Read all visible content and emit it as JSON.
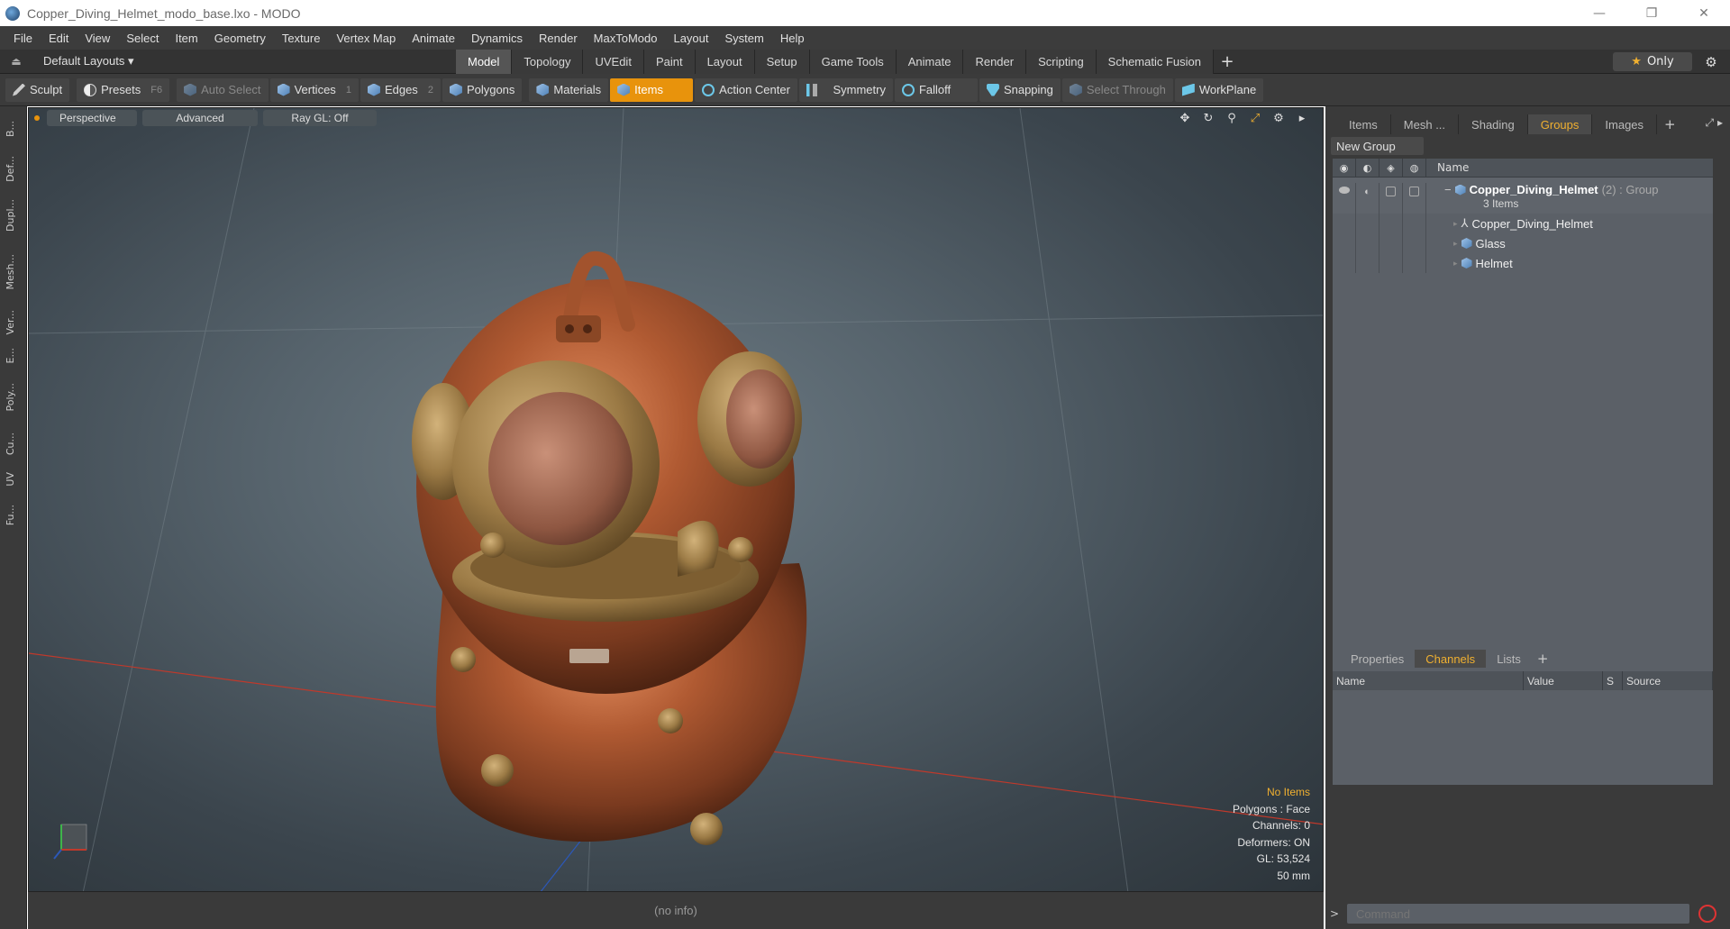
{
  "window": {
    "title": "Copper_Diving_Helmet_modo_base.lxo - MODO",
    "buttons": [
      "—",
      "❐",
      "✕"
    ]
  },
  "menu": [
    "File",
    "Edit",
    "View",
    "Select",
    "Item",
    "Geometry",
    "Texture",
    "Vertex Map",
    "Animate",
    "Dynamics",
    "Render",
    "MaxToModo",
    "Layout",
    "System",
    "Help"
  ],
  "layout_bar": {
    "layouts_label": "Default Layouts ▾",
    "tabs": [
      "Model",
      "Topology",
      "UVEdit",
      "Paint",
      "Layout",
      "Setup",
      "Game Tools",
      "Animate",
      "Render",
      "Scripting",
      "Schematic Fusion"
    ],
    "active_tab": "Model",
    "only_label": "Only"
  },
  "toolbar": {
    "sculpt": "Sculpt",
    "presets": "Presets",
    "presets_key": "F6",
    "auto_select": "Auto Select",
    "vertices": "Vertices",
    "vertices_key": "1",
    "edges": "Edges",
    "edges_key": "2",
    "polygons": "Polygons",
    "materials": "Materials",
    "items": "Items",
    "action_center": "Action Center",
    "symmetry": "Symmetry",
    "falloff": "Falloff",
    "snapping": "Snapping",
    "select_through": "Select Through",
    "workplane": "WorkPlane"
  },
  "left_tabs": [
    "B...",
    "Def...",
    "Dupl...",
    "Mesh...",
    "Ver...",
    "E...",
    "Poly...",
    "Cu...",
    "UV",
    "Fu..."
  ],
  "viewport": {
    "view_label": "Perspective",
    "shading_label": "Advanced",
    "raygl_label": "Ray GL: Off",
    "info": {
      "selection": "No Items",
      "polygons": "Polygons : Face",
      "channels": "Channels: 0",
      "deformers": "Deformers: ON",
      "gl": "GL: 53,524",
      "lens": "50 mm"
    },
    "status": "(no info)"
  },
  "right_panel": {
    "tabs": [
      "Items",
      "Mesh ...",
      "Shading",
      "Groups",
      "Images"
    ],
    "active_tab": "Groups",
    "new_group_label": "New Group",
    "name_header": "Name",
    "group": {
      "name": "Copper_Diving_Helmet",
      "meta": "(2) : Group",
      "count": "3 Items",
      "children": [
        "Copper_Diving_Helmet",
        "Glass",
        "Helmet"
      ]
    },
    "bottom_tabs": [
      "Properties",
      "Channels",
      "Lists"
    ],
    "bottom_active": "Channels",
    "channel_headers": [
      "Name",
      "Value",
      "S",
      "Source"
    ],
    "command_placeholder": "Command"
  },
  "colors": {
    "accent": "#e8930c",
    "highlight_text": "#f0b030",
    "copper": "#a4552f",
    "brass": "#9b7a45"
  }
}
